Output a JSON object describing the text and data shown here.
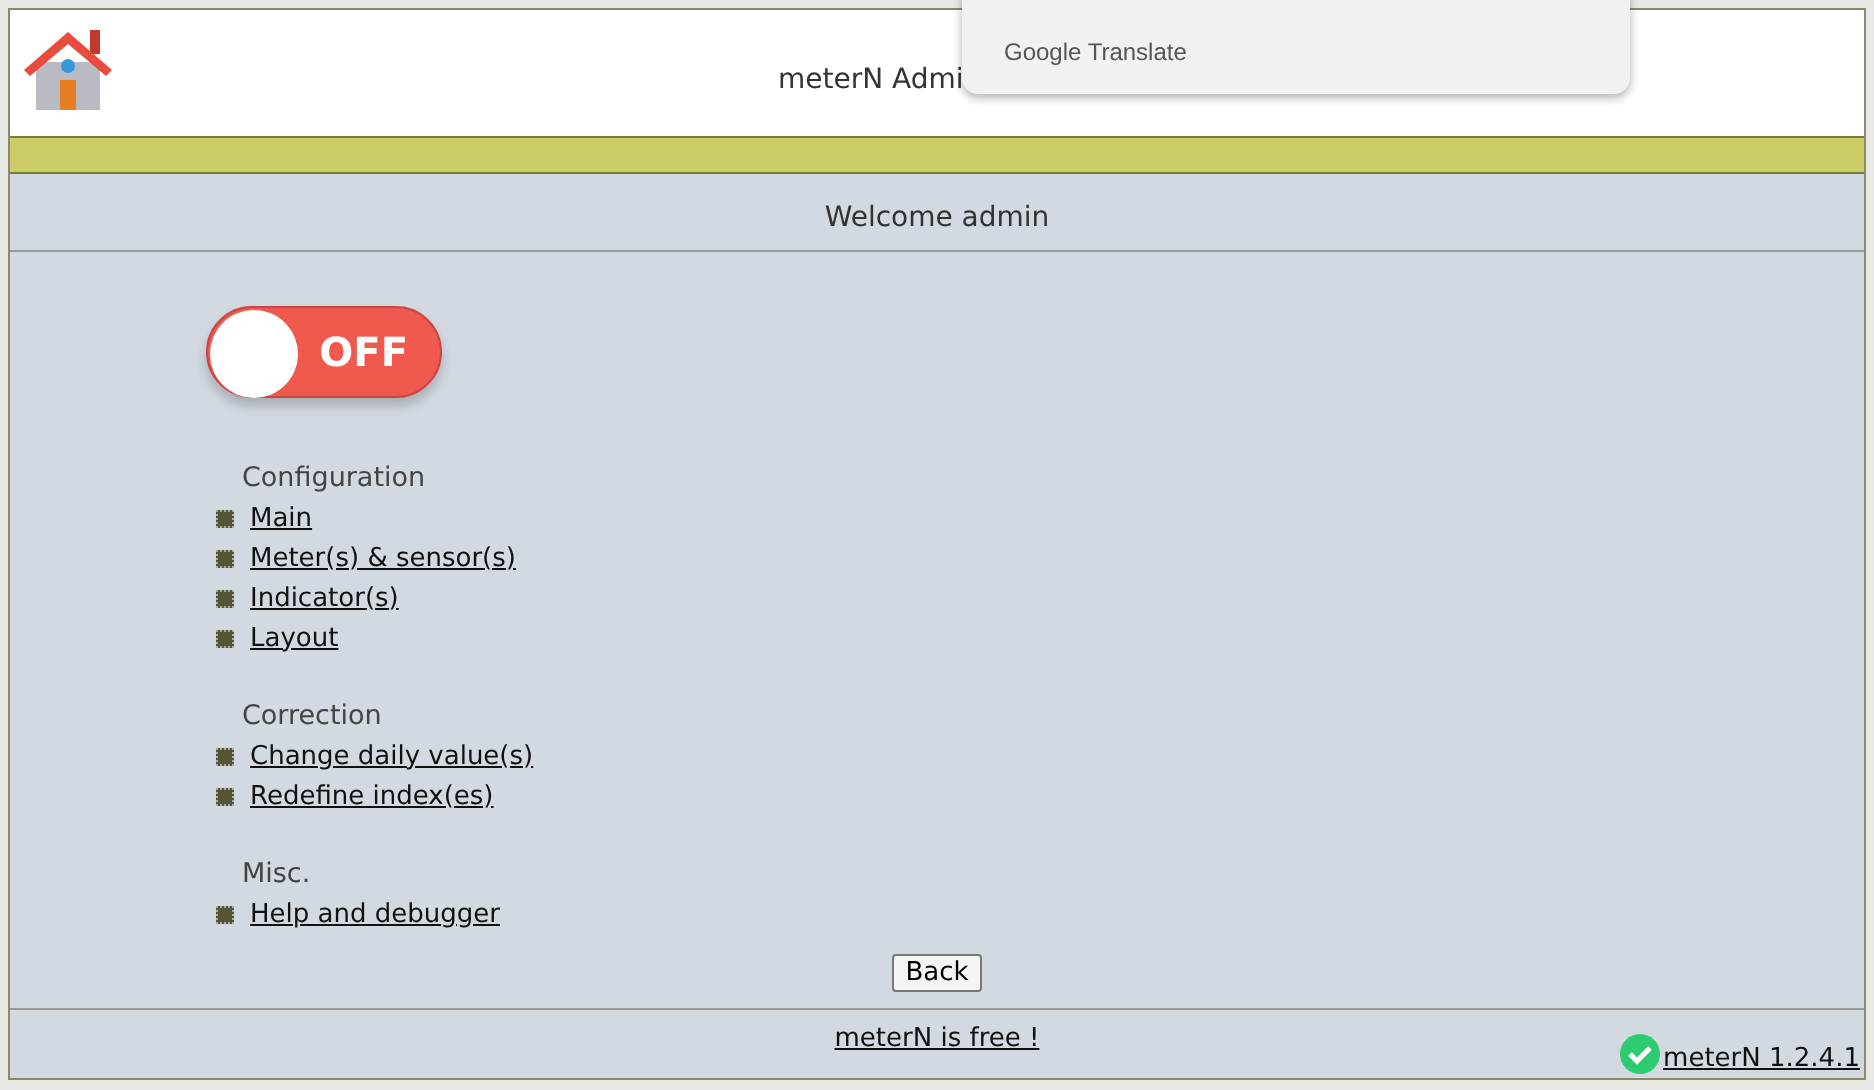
{
  "header": {
    "title": "meterN Admi"
  },
  "translate_popup": {
    "label": "Google Translate"
  },
  "welcome": "Welcome admin",
  "toggle": {
    "label": "OFF",
    "on": false
  },
  "sections": [
    {
      "heading": "Configuration",
      "links": [
        "Main",
        "Meter(s) & sensor(s)",
        "Indicator(s)",
        "Layout"
      ]
    },
    {
      "heading": "Correction",
      "links": [
        "Change daily value(s)",
        "Redefine index(es)"
      ]
    },
    {
      "heading": "Misc.",
      "links": [
        "Help and debugger"
      ]
    }
  ],
  "back_button": "Back",
  "footer": {
    "free_link": "meterN is free !",
    "version_link": "meterN 1.2.4.1"
  }
}
